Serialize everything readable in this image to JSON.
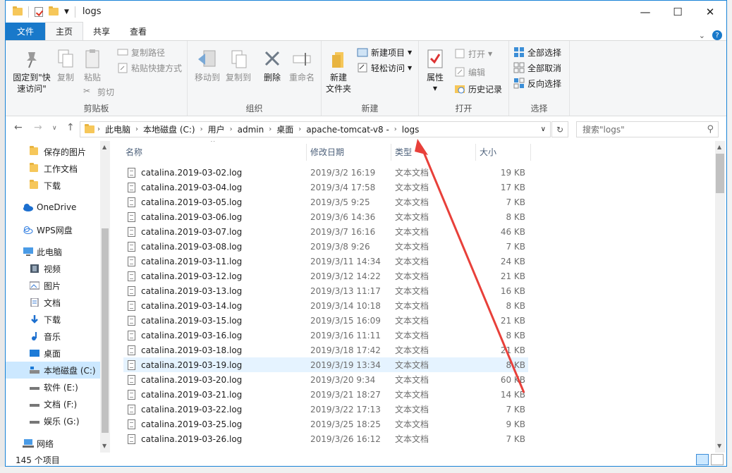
{
  "window": {
    "title": "logs",
    "controls": {
      "minimize": "—",
      "maximize": "☐",
      "close": "✕"
    }
  },
  "ribbon_tabs": [
    "文件",
    "主页",
    "共享",
    "查看"
  ],
  "ribbon": {
    "clipboard": {
      "label": "剪贴板",
      "pin": "固定到\"快\n速访问\"",
      "copy": "复制",
      "paste": "粘贴",
      "copy_path": "复制路径",
      "paste_shortcut": "粘贴快捷方式",
      "cut": "剪切"
    },
    "organize": {
      "label": "组织",
      "move_to": "移动到",
      "copy_to": "复制到",
      "delete": "删除",
      "rename": "重命名"
    },
    "new": {
      "label": "新建",
      "new_folder": "新建\n文件夹",
      "new_item": "新建项目",
      "easy_access": "轻松访问"
    },
    "open": {
      "label": "打开",
      "properties": "属性",
      "open": "打开",
      "edit": "编辑",
      "history": "历史记录"
    },
    "select": {
      "label": "选择",
      "select_all": "全部选择",
      "select_none": "全部取消",
      "invert": "反向选择"
    }
  },
  "address": {
    "crumbs": [
      "此电脑",
      "本地磁盘 (C:)",
      "用户",
      "admin",
      "桌面",
      "apache-tomcat-v8 -",
      "logs"
    ],
    "search_placeholder": "搜索\"logs\""
  },
  "nav": {
    "items": [
      {
        "label": "保存的图片",
        "icon": "folder-icon"
      },
      {
        "label": "工作文档",
        "icon": "folder-icon"
      },
      {
        "label": "下载",
        "icon": "folder-icon"
      },
      {
        "label": "OneDrive",
        "icon": "cloud-icon"
      },
      {
        "label": "WPS网盘",
        "icon": "cloud-outline-icon"
      },
      {
        "label": "此电脑",
        "icon": "computer-icon"
      },
      {
        "label": "视频",
        "icon": "video-icon"
      },
      {
        "label": "图片",
        "icon": "picture-icon"
      },
      {
        "label": "文档",
        "icon": "document-icon"
      },
      {
        "label": "下载",
        "icon": "download-icon"
      },
      {
        "label": "音乐",
        "icon": "music-icon"
      },
      {
        "label": "桌面",
        "icon": "desktop-icon"
      },
      {
        "label": "本地磁盘 (C:)",
        "icon": "drive-icon"
      },
      {
        "label": "软件 (E:)",
        "icon": "drive-icon"
      },
      {
        "label": "文档 (F:)",
        "icon": "drive-icon"
      },
      {
        "label": "娱乐 (G:)",
        "icon": "drive-icon"
      },
      {
        "label": "网络",
        "icon": "network-icon"
      }
    ]
  },
  "columns": {
    "name": "名称",
    "date": "修改日期",
    "type": "类型",
    "size": "大小"
  },
  "files": [
    {
      "name": "catalina.2019-03-02.log",
      "date": "2019/3/2 16:19",
      "type": "文本文档",
      "size": "19 KB"
    },
    {
      "name": "catalina.2019-03-04.log",
      "date": "2019/3/4 17:58",
      "type": "文本文档",
      "size": "17 KB"
    },
    {
      "name": "catalina.2019-03-05.log",
      "date": "2019/3/5 9:25",
      "type": "文本文档",
      "size": "7 KB"
    },
    {
      "name": "catalina.2019-03-06.log",
      "date": "2019/3/6 14:36",
      "type": "文本文档",
      "size": "8 KB"
    },
    {
      "name": "catalina.2019-03-07.log",
      "date": "2019/3/7 16:16",
      "type": "文本文档",
      "size": "46 KB"
    },
    {
      "name": "catalina.2019-03-08.log",
      "date": "2019/3/8 9:26",
      "type": "文本文档",
      "size": "7 KB"
    },
    {
      "name": "catalina.2019-03-11.log",
      "date": "2019/3/11 14:34",
      "type": "文本文档",
      "size": "24 KB"
    },
    {
      "name": "catalina.2019-03-12.log",
      "date": "2019/3/12 14:22",
      "type": "文本文档",
      "size": "21 KB"
    },
    {
      "name": "catalina.2019-03-13.log",
      "date": "2019/3/13 11:17",
      "type": "文本文档",
      "size": "16 KB"
    },
    {
      "name": "catalina.2019-03-14.log",
      "date": "2019/3/14 10:18",
      "type": "文本文档",
      "size": "8 KB"
    },
    {
      "name": "catalina.2019-03-15.log",
      "date": "2019/3/15 16:09",
      "type": "文本文档",
      "size": "21 KB"
    },
    {
      "name": "catalina.2019-03-16.log",
      "date": "2019/3/16 11:11",
      "type": "文本文档",
      "size": "8 KB"
    },
    {
      "name": "catalina.2019-03-18.log",
      "date": "2019/3/18 17:42",
      "type": "文本文档",
      "size": "21 KB"
    },
    {
      "name": "catalina.2019-03-19.log",
      "date": "2019/3/19 13:34",
      "type": "文本文档",
      "size": "8 KB"
    },
    {
      "name": "catalina.2019-03-20.log",
      "date": "2019/3/20 9:34",
      "type": "文本文档",
      "size": "60 KB"
    },
    {
      "name": "catalina.2019-03-21.log",
      "date": "2019/3/21 18:27",
      "type": "文本文档",
      "size": "14 KB"
    },
    {
      "name": "catalina.2019-03-22.log",
      "date": "2019/3/22 17:13",
      "type": "文本文档",
      "size": "7 KB"
    },
    {
      "name": "catalina.2019-03-25.log",
      "date": "2019/3/25 18:25",
      "type": "文本文档",
      "size": "9 KB"
    },
    {
      "name": "catalina.2019-03-26.log",
      "date": "2019/3/26 16:12",
      "type": "文本文档",
      "size": "7 KB"
    }
  ],
  "selected_file": "catalina.2019-03-19.log",
  "status": {
    "count": "145 个项目"
  },
  "colors": {
    "accent": "#1979ca",
    "selection": "#e5f3ff",
    "annotation_arrow": "#e8403a"
  }
}
